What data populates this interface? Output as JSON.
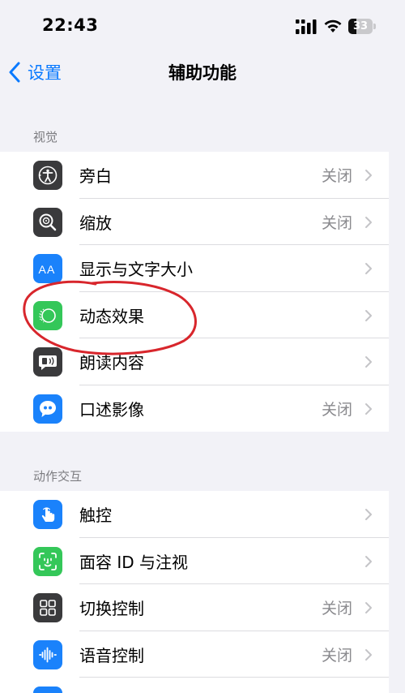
{
  "status": {
    "time": "22:43",
    "battery": "33",
    "battery_level": 0.33
  },
  "nav": {
    "back_label": "设置",
    "title": "辅助功能"
  },
  "sections": [
    {
      "header": "视觉",
      "items": [
        {
          "label": "旁白",
          "value": "关闭",
          "icon": "voiceover-icon",
          "color": "#3a3a3c"
        },
        {
          "label": "缩放",
          "value": "关闭",
          "icon": "zoom-icon",
          "color": "#3a3a3c"
        },
        {
          "label": "显示与文字大小",
          "value": "",
          "icon": "text-size-icon",
          "color": "#1a82fb"
        },
        {
          "label": "动态效果",
          "value": "",
          "icon": "motion-icon",
          "color": "#34c759"
        },
        {
          "label": "朗读内容",
          "value": "",
          "icon": "spoken-content-icon",
          "color": "#3a3a3c"
        },
        {
          "label": "口述影像",
          "value": "关闭",
          "icon": "audio-description-icon",
          "color": "#1a82fb"
        }
      ]
    },
    {
      "header": "动作交互",
      "items": [
        {
          "label": "触控",
          "value": "",
          "icon": "touch-icon",
          "color": "#1a82fb"
        },
        {
          "label": "面容 ID 与注视",
          "value": "",
          "icon": "face-id-icon",
          "color": "#34c759"
        },
        {
          "label": "切换控制",
          "value": "关闭",
          "icon": "switch-control-icon",
          "color": "#3a3a3c"
        },
        {
          "label": "语音控制",
          "value": "关闭",
          "icon": "voice-control-icon",
          "color": "#1a82fb"
        }
      ]
    }
  ],
  "colors": {
    "accent": "#0a7aff",
    "annotation": "#d8262c",
    "background": "#f2f2f7"
  }
}
